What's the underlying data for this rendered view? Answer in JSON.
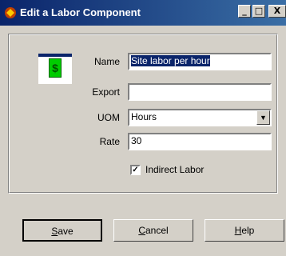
{
  "window": {
    "title": "Edit a Labor Component",
    "controls": {
      "minimize": "_",
      "maximize": "□",
      "close": "X"
    }
  },
  "form": {
    "name_label": "Name",
    "name_value": "Site labor per hour",
    "export_label": "Export",
    "export_value": "",
    "uom_label": "UOM",
    "uom_value": "Hours",
    "rate_label": "Rate",
    "rate_value": "30",
    "indirect_label": "Indirect Labor",
    "indirect_checked": true,
    "icon_glyph": "$"
  },
  "buttons": {
    "save_rest": "ave",
    "save_key": "S",
    "cancel_rest": "ancel",
    "cancel_key": "C",
    "help_rest": "elp",
    "help_key": "H"
  }
}
